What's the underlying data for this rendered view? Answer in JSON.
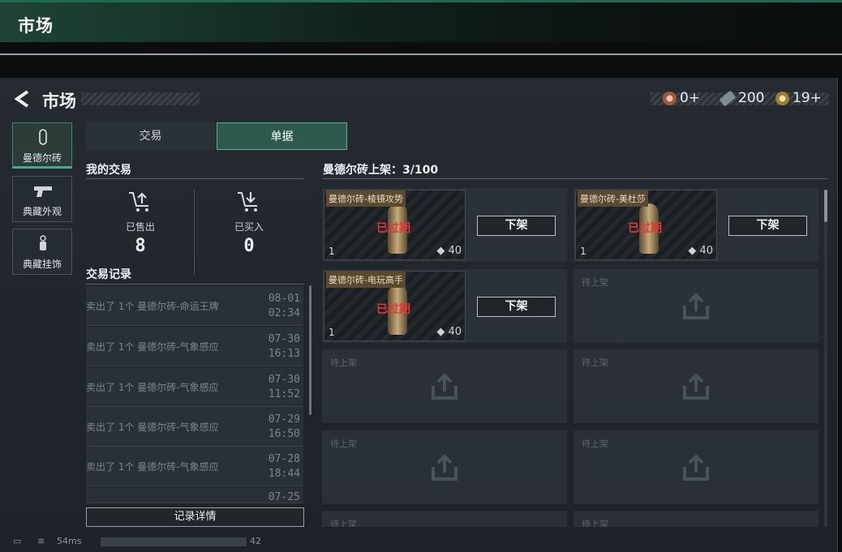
{
  "top": {
    "title": "市场"
  },
  "header": {
    "title": "市场"
  },
  "currency": [
    {
      "icon": "bronze-coin-icon",
      "value": "0+"
    },
    {
      "icon": "cash-icon",
      "value": "200"
    },
    {
      "icon": "gold-coin-icon",
      "value": "19+"
    }
  ],
  "categories": [
    {
      "label": "曼德尔砖",
      "icon": "brick-icon"
    },
    {
      "label": "典藏外观",
      "icon": "pistol-icon"
    },
    {
      "label": "典藏挂饰",
      "icon": "charm-icon"
    }
  ],
  "tabs": {
    "trade": "交易",
    "orders": "单据"
  },
  "my_trades": {
    "title": "我的交易",
    "sold_label": "已售出",
    "sold_value": "8",
    "bought_label": "已买入",
    "bought_value": "0"
  },
  "history": {
    "title": "交易记录",
    "rows": [
      {
        "text": "卖出了 1个 曼德尔砖-命运王牌",
        "date": "08-01",
        "time": "02:34"
      },
      {
        "text": "卖出了 1个 曼德尔砖-气象感应",
        "date": "07-30",
        "time": "16:13"
      },
      {
        "text": "卖出了 1个 曼德尔砖-气象感应",
        "date": "07-30",
        "time": "11:52"
      },
      {
        "text": "卖出了 1个 曼德尔砖-气象感应",
        "date": "07-29",
        "time": "16:50"
      },
      {
        "text": "卖出了 1个 曼德尔砖-气象感应",
        "date": "07-28",
        "time": "18:44"
      }
    ],
    "partial_date": "07-25",
    "detail_button": "记录详情"
  },
  "listings": {
    "title": "曼德尔砖上架：3/100",
    "items": [
      {
        "name": "曼德尔砖-棱镜攻势",
        "status": "已过期",
        "qty": "1",
        "price": "40",
        "button": "下架"
      },
      {
        "name": "曼德尔砖-美杜莎",
        "status": "已过期",
        "qty": "1",
        "price": "40",
        "button": "下架"
      },
      {
        "name": "曼德尔砖-电玩高手",
        "status": "已过期",
        "qty": "1",
        "price": "40",
        "button": "下架"
      }
    ],
    "empty_label": "待上架"
  },
  "status_bar": {
    "ping": "54ms",
    "code": "42"
  }
}
